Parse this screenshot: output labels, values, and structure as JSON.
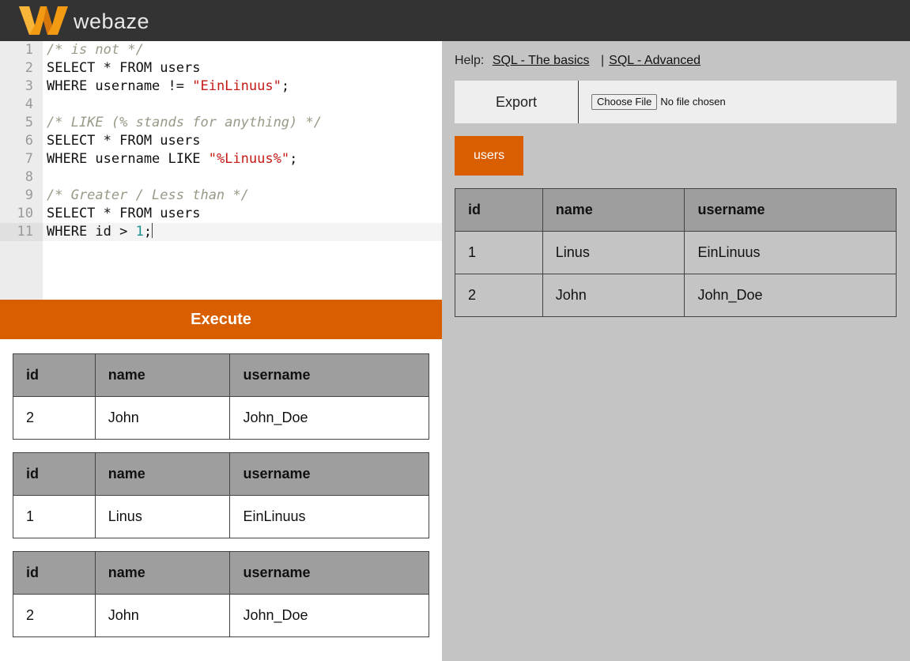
{
  "app": {
    "name": "webaze",
    "logo_letter": "W",
    "brand_color": "#d95e00",
    "header_color": "#333333"
  },
  "editor": {
    "lines": [
      {
        "num": "1",
        "segments": [
          {
            "t": "/* is not */",
            "c": "comment"
          }
        ]
      },
      {
        "num": "2",
        "segments": [
          {
            "t": "SELECT * FROM users",
            "c": "plain"
          }
        ]
      },
      {
        "num": "3",
        "segments": [
          {
            "t": "WHERE username != ",
            "c": "plain"
          },
          {
            "t": "\"EinLinuus\"",
            "c": "string"
          },
          {
            "t": ";",
            "c": "plain"
          }
        ]
      },
      {
        "num": "4",
        "segments": []
      },
      {
        "num": "5",
        "segments": [
          {
            "t": "/* LIKE (% stands for anything) */",
            "c": "comment"
          }
        ]
      },
      {
        "num": "6",
        "segments": [
          {
            "t": "SELECT * FROM users",
            "c": "plain"
          }
        ]
      },
      {
        "num": "7",
        "segments": [
          {
            "t": "WHERE username LIKE ",
            "c": "plain"
          },
          {
            "t": "\"%Linuus%\"",
            "c": "string"
          },
          {
            "t": ";",
            "c": "plain"
          }
        ]
      },
      {
        "num": "8",
        "segments": []
      },
      {
        "num": "9",
        "segments": [
          {
            "t": "/* Greater / Less than */",
            "c": "comment"
          }
        ]
      },
      {
        "num": "10",
        "segments": [
          {
            "t": "SELECT * FROM users",
            "c": "plain"
          }
        ]
      },
      {
        "num": "11",
        "segments": [
          {
            "t": "WHERE id > ",
            "c": "plain"
          },
          {
            "t": "1",
            "c": "number"
          },
          {
            "t": ";",
            "c": "plain"
          }
        ],
        "active": true
      }
    ]
  },
  "execute_label": "Execute",
  "results": [
    {
      "headers": [
        "id",
        "name",
        "username"
      ],
      "rows": [
        [
          "2",
          "John",
          "John_Doe"
        ]
      ]
    },
    {
      "headers": [
        "id",
        "name",
        "username"
      ],
      "rows": [
        [
          "1",
          "Linus",
          "EinLinuus"
        ]
      ]
    },
    {
      "headers": [
        "id",
        "name",
        "username"
      ],
      "rows": [
        [
          "2",
          "John",
          "John_Doe"
        ]
      ]
    }
  ],
  "help": {
    "label": "Help:",
    "link1": "SQL - The basics",
    "separator": "|",
    "link2": "SQL - Advanced"
  },
  "toolbar": {
    "export_label": "Export",
    "choose_file_label": "Choose File",
    "file_status": "No file chosen"
  },
  "table_tabs": [
    "users"
  ],
  "db_table": {
    "headers": [
      "id",
      "name",
      "username"
    ],
    "rows": [
      [
        "1",
        "Linus",
        "EinLinuus"
      ],
      [
        "2",
        "John",
        "John_Doe"
      ]
    ]
  }
}
